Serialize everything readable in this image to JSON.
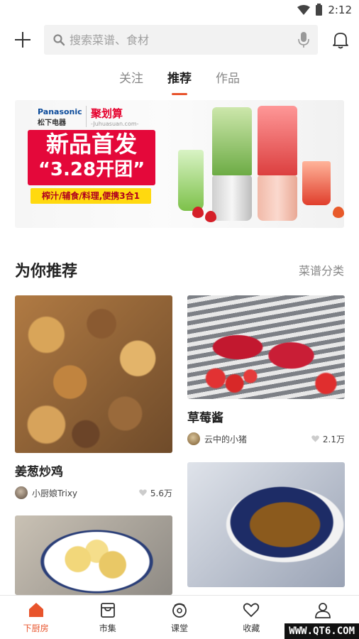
{
  "status_bar": {
    "time": "2:12"
  },
  "search": {
    "placeholder": "搜索菜谱、食材"
  },
  "tabs": [
    {
      "label": "关注",
      "active": false
    },
    {
      "label": "推荐",
      "active": true
    },
    {
      "label": "作品",
      "active": false
    }
  ],
  "banner": {
    "brand_en": "Panasonic",
    "brand_cn": "松下电器",
    "partner": "聚划算",
    "partner_url": "-Juhuasuan.com-",
    "headline": "新品首发",
    "subline": "“3.28开团”",
    "tagline": "榨汁/辅食/料理,便携3合1"
  },
  "section": {
    "title": "为你推荐",
    "link": "菜谱分类"
  },
  "recipes": [
    {
      "title": "姜葱炒鸡",
      "author": "小厨娘Trixy",
      "likes": "5.6万"
    },
    {
      "title": "草莓酱",
      "author": "云中的小猪",
      "likes": "2.1万"
    }
  ],
  "bottom_nav": [
    {
      "label": "下厨房",
      "icon": "home-icon",
      "active": true
    },
    {
      "label": "市集",
      "icon": "market-icon",
      "active": false
    },
    {
      "label": "课堂",
      "icon": "class-icon",
      "active": false
    },
    {
      "label": "收藏",
      "icon": "heart-icon",
      "active": false
    },
    {
      "label": "我",
      "icon": "profile-icon",
      "active": false
    }
  ],
  "watermark": "WWW.QT6.COM",
  "colors": {
    "accent": "#e8542c",
    "banner_red": "#e4083a",
    "banner_yellow": "#ffd90f"
  }
}
